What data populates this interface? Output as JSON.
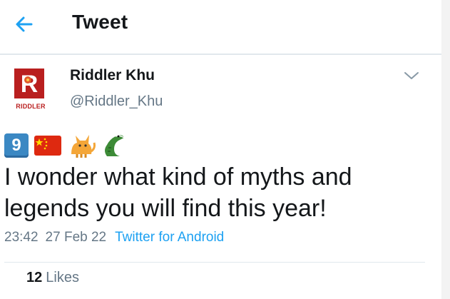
{
  "header": {
    "title": "Tweet",
    "back_icon": "arrow-left-icon",
    "accent_color": "#1da1f2"
  },
  "author": {
    "display_name": "Riddler Khu",
    "handle": "@Riddler_Khu",
    "avatar_logo_text": "RIDDLER",
    "avatar_letter": "R"
  },
  "tweet": {
    "emojis": [
      "keycap-9",
      "flag-china",
      "cat",
      "crocodile"
    ],
    "keycap_label": "9",
    "text": "I wonder what kind of myths and legends you will find this year!",
    "time": "23:42",
    "date": "27 Feb 22",
    "source": "Twitter for Android"
  },
  "stats": {
    "likes_count": "12",
    "likes_label": "Likes"
  }
}
